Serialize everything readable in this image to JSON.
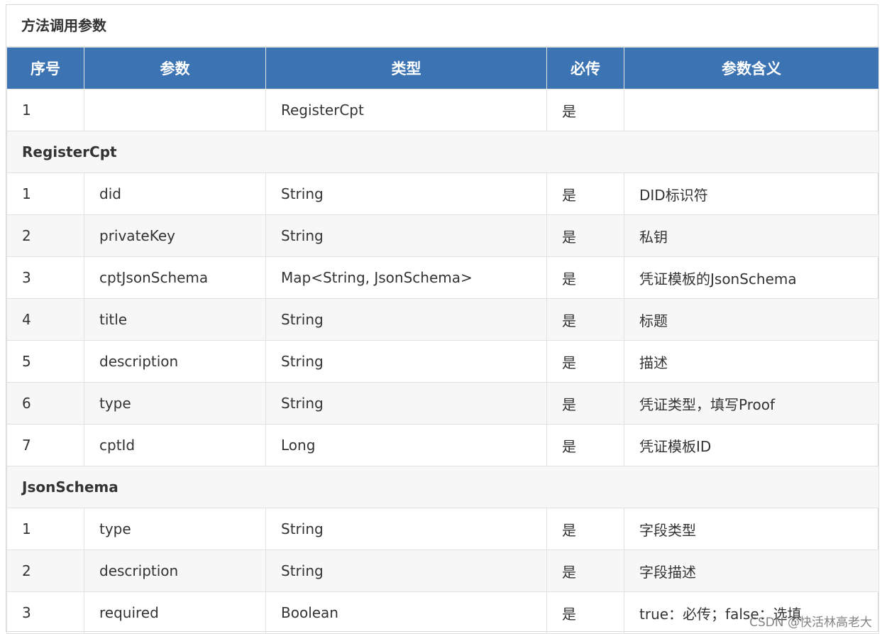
{
  "caption": "方法调用参数",
  "headers": [
    "序号",
    "参数",
    "类型",
    "必传",
    "参数含义"
  ],
  "rows": [
    {
      "kind": "data",
      "cells": [
        "1",
        "",
        "RegisterCpt",
        "是",
        ""
      ]
    },
    {
      "kind": "section",
      "label": "RegisterCpt"
    },
    {
      "kind": "data",
      "cells": [
        "1",
        "did",
        "String",
        "是",
        "DID标识符"
      ]
    },
    {
      "kind": "data",
      "cells": [
        "2",
        "privateKey",
        "String",
        "是",
        "私钥"
      ]
    },
    {
      "kind": "data",
      "cells": [
        "3",
        "cptJsonSchema",
        "Map<String, JsonSchema>",
        "是",
        "凭证模板的JsonSchema"
      ]
    },
    {
      "kind": "data",
      "cells": [
        "4",
        "title",
        "String",
        "是",
        "标题"
      ]
    },
    {
      "kind": "data",
      "cells": [
        "5",
        "description",
        "String",
        "是",
        "描述"
      ]
    },
    {
      "kind": "data",
      "cells": [
        "6",
        "type",
        "String",
        "是",
        "凭证类型，填写Proof"
      ]
    },
    {
      "kind": "data",
      "cells": [
        "7",
        "cptId",
        "Long",
        "是",
        "凭证模板ID"
      ]
    },
    {
      "kind": "section",
      "label": "JsonSchema"
    },
    {
      "kind": "data",
      "cells": [
        "1",
        "type",
        "String",
        "是",
        "字段类型"
      ]
    },
    {
      "kind": "data",
      "cells": [
        "2",
        "description",
        "String",
        "是",
        "字段描述"
      ]
    },
    {
      "kind": "data",
      "cells": [
        "3",
        "required",
        "Boolean",
        "是",
        "true：必传；false：选填"
      ]
    }
  ],
  "watermark": "CSDN @快活林高老大",
  "colors": {
    "header_bg": "#3c74b3",
    "stripe_bg": "#f7f7f7"
  }
}
